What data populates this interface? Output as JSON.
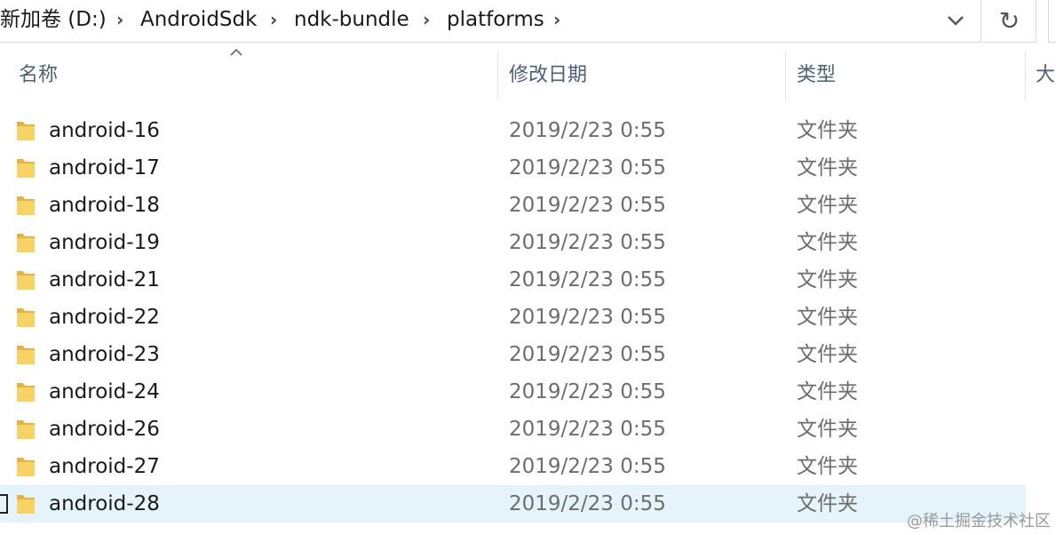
{
  "address_bar": {
    "crumbs": [
      "新加卷 (D:)",
      "AndroidSdk",
      "ndk-bundle",
      "platforms"
    ]
  },
  "columns": {
    "name": "名称",
    "date": "修改日期",
    "type": "类型",
    "size": "大"
  },
  "sort": {
    "column": "name",
    "direction": "ascending"
  },
  "rows": [
    {
      "name": "android-16",
      "date": "2019/2/23 0:55",
      "type": "文件夹"
    },
    {
      "name": "android-17",
      "date": "2019/2/23 0:55",
      "type": "文件夹"
    },
    {
      "name": "android-18",
      "date": "2019/2/23 0:55",
      "type": "文件夹"
    },
    {
      "name": "android-19",
      "date": "2019/2/23 0:55",
      "type": "文件夹"
    },
    {
      "name": "android-21",
      "date": "2019/2/23 0:55",
      "type": "文件夹"
    },
    {
      "name": "android-22",
      "date": "2019/2/23 0:55",
      "type": "文件夹"
    },
    {
      "name": "android-23",
      "date": "2019/2/23 0:55",
      "type": "文件夹"
    },
    {
      "name": "android-24",
      "date": "2019/2/23 0:55",
      "type": "文件夹"
    },
    {
      "name": "android-26",
      "date": "2019/2/23 0:55",
      "type": "文件夹"
    },
    {
      "name": "android-27",
      "date": "2019/2/23 0:55",
      "type": "文件夹"
    },
    {
      "name": "android-28",
      "date": "2019/2/23 0:55",
      "type": "文件夹",
      "selected": true
    }
  ],
  "watermark": "@稀土掘金技术社区",
  "icons": {
    "folder": "folder-icon",
    "breadcrumb_separator": "chevron-right-icon",
    "dropdown": "chevron-down-icon",
    "refresh": "refresh-icon",
    "sort": "sort-ascending-icon"
  },
  "colors": {
    "selected_row": "#e5f3fb",
    "header_text": "#4c607a",
    "folder": "#f4c542"
  }
}
